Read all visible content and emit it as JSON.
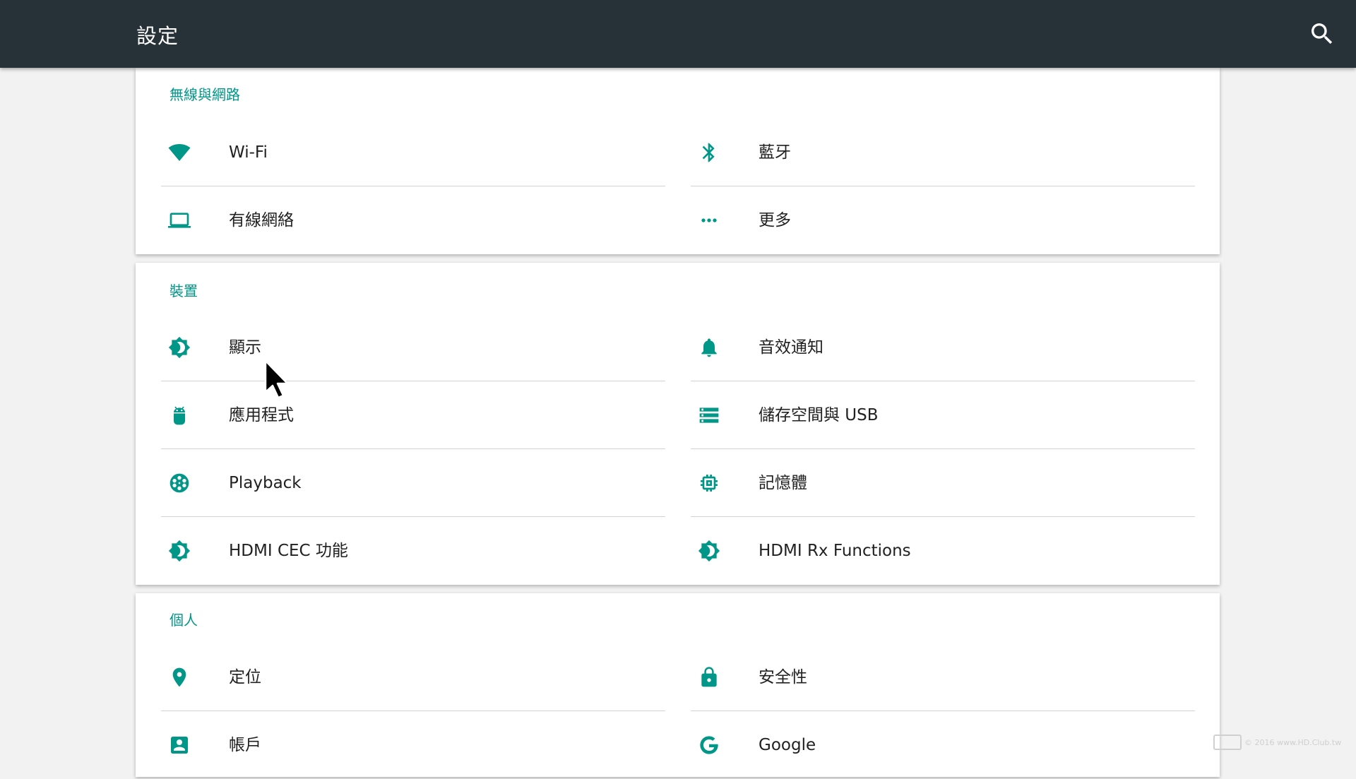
{
  "appbar": {
    "title": "設定",
    "search_icon": "search-icon"
  },
  "colors": {
    "appbar_bg": "#263238",
    "accent": "#009688",
    "page_bg": "#f2f2f2",
    "card_bg": "#ffffff"
  },
  "sections": [
    {
      "header": "無線與網路",
      "items": [
        {
          "label": "Wi-Fi",
          "icon": "wifi-icon"
        },
        {
          "label": "藍牙",
          "icon": "bluetooth-icon"
        },
        {
          "label": "有線網絡",
          "icon": "laptop-icon"
        },
        {
          "label": "更多",
          "icon": "more-horiz-icon"
        }
      ]
    },
    {
      "header": "裝置",
      "items": [
        {
          "label": "顯示",
          "icon": "brightness-icon"
        },
        {
          "label": "音效通知",
          "icon": "bell-icon"
        },
        {
          "label": "應用程式",
          "icon": "android-icon"
        },
        {
          "label": "儲存空間與 USB",
          "icon": "storage-icon"
        },
        {
          "label": "Playback",
          "icon": "film-reel-icon"
        },
        {
          "label": "記憶體",
          "icon": "memory-icon"
        },
        {
          "label": "HDMI CEC 功能",
          "icon": "brightness-icon"
        },
        {
          "label": "HDMI Rx Functions",
          "icon": "brightness-icon"
        }
      ]
    },
    {
      "header": "個人",
      "items": [
        {
          "label": "定位",
          "icon": "location-pin-icon"
        },
        {
          "label": "安全性",
          "icon": "lock-icon"
        },
        {
          "label": "帳戶",
          "icon": "account-box-icon"
        },
        {
          "label": "Google",
          "icon": "google-icon"
        }
      ]
    }
  ],
  "watermark": {
    "text": "© 2016 www.HD.Club.tw"
  }
}
